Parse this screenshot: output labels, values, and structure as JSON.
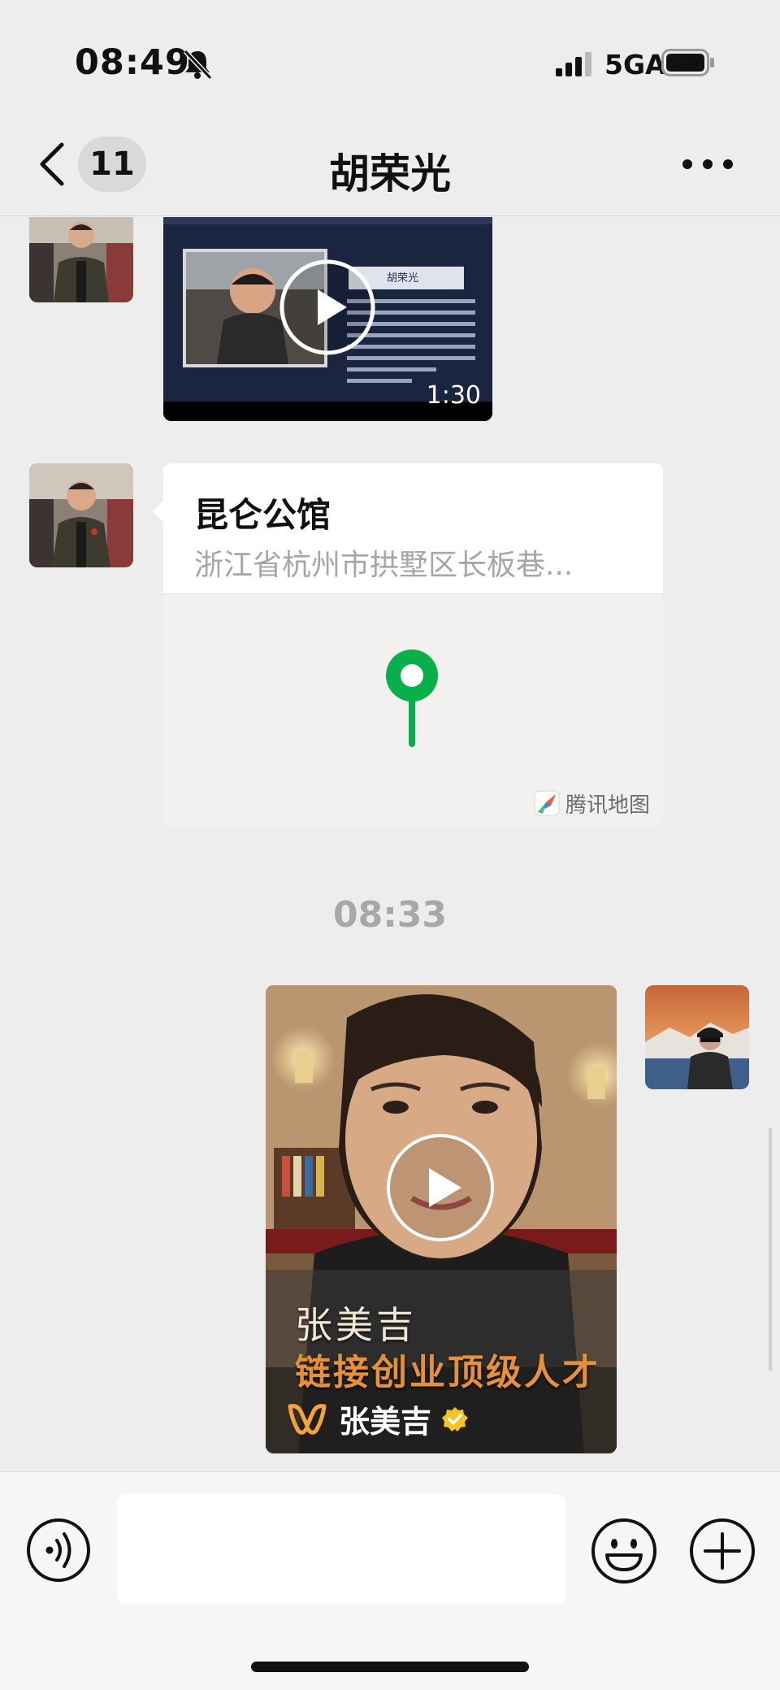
{
  "status_bar": {
    "time": "08:49",
    "network": "5GA",
    "icons": [
      "bell-slash-icon",
      "signal-icon",
      "battery-icon"
    ]
  },
  "nav": {
    "unread_count": "11",
    "title": "胡荣光",
    "icons": [
      "chevron-left-icon",
      "more-icon"
    ]
  },
  "messages": [
    {
      "type": "video",
      "direction": "incoming",
      "duration": "1:30",
      "thumbnail_caption": "胡荣光"
    },
    {
      "type": "location",
      "direction": "incoming",
      "name": "昆仑公馆",
      "address": "浙江省杭州市拱墅区长板巷...",
      "map_provider": "腾讯地图",
      "pin_color": "#07b04a"
    },
    {
      "type": "timestamp",
      "text": "08:33"
    },
    {
      "type": "channels_video",
      "direction": "outgoing",
      "caption_line1": "张美吉",
      "caption_line2": "链接创业顶级人才",
      "channel_name": "张美吉",
      "channel_icon": "channels-logo-icon",
      "verified": true
    }
  ],
  "input_bar": {
    "placeholder": "",
    "icons": [
      "voice-icon",
      "emoji-icon",
      "plus-icon"
    ]
  },
  "colors": {
    "background": "#ededed",
    "accent_green": "#07b04a",
    "channels_orange": "#f3a33a",
    "verified_yellow": "#f7c325"
  }
}
